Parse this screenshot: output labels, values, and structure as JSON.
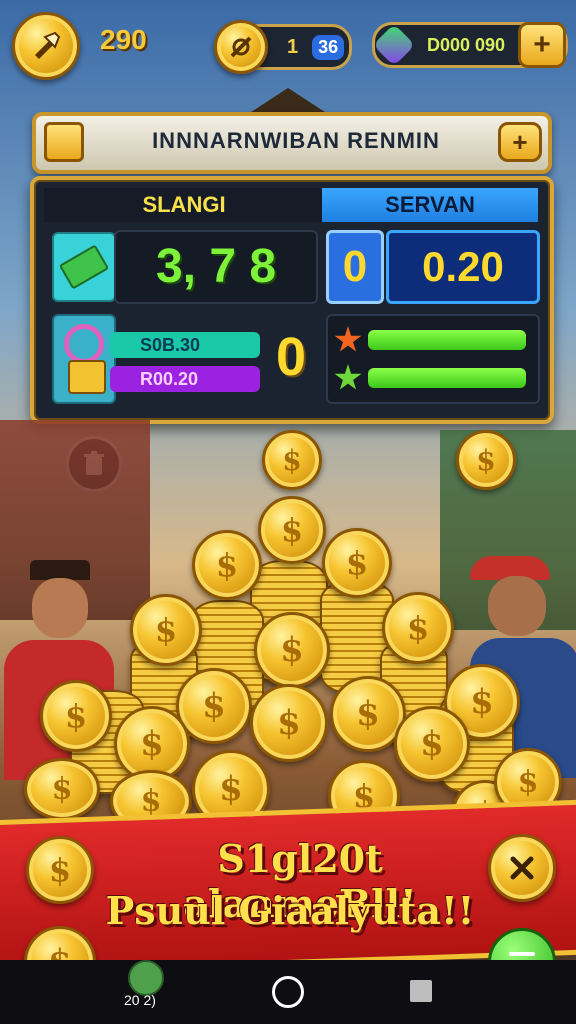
{
  "top_bar": {
    "score": "290",
    "mid_counter": "1",
    "mid_badge": "36",
    "currency": "D000 090",
    "plus_symbol": "+"
  },
  "banner": {
    "title": "INNNARNWIBAN RENMIN",
    "plus_symbol": "+"
  },
  "panel": {
    "left_header": "SLANGI",
    "right_header": "SERVAN",
    "main_value": "3, 7 8",
    "zero_box_value": "0",
    "right_value": "0.20",
    "bar1_label": "S0B.30",
    "bar2_label": "R00.20",
    "middle_zero": "0"
  },
  "bottom": {
    "line1": "S1gl20t alanmeBll!",
    "line2": "Psuul Giaalyuta!!",
    "count_label": "20 2)"
  },
  "colors": {
    "gold": "#f7c531",
    "panel_bg": "#1c2330",
    "green_value": "#7ef23a",
    "yellow_value": "#ffd92e",
    "blue_header": "#1f8ff0",
    "red_banner": "#d41e1e"
  },
  "icons": {
    "top_left": "hammer-icon",
    "mid": "slash-coin-icon",
    "gem": "gem-icon",
    "trash": "trash-icon",
    "close": "close-icon",
    "menu": "menu-icon",
    "home": "home-circle-icon",
    "recent": "square-icon"
  }
}
